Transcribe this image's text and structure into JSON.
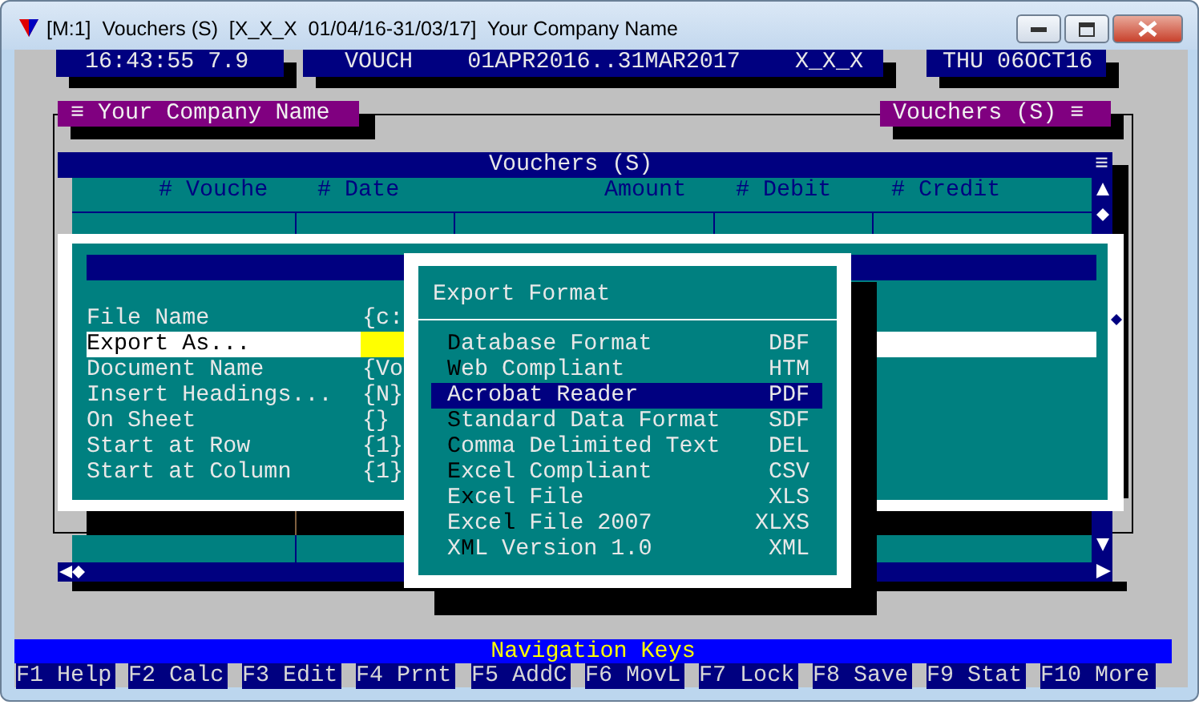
{
  "window": {
    "title": "[M:1]  Vouchers (S)  [X_X_X  01/04/16-31/03/17]  Your Company Name"
  },
  "info_boxes": [
    "16:43:55 7.9",
    "VOUCH    01APR2016..31MAR2017    X_X_X",
    "THU 06OCT16"
  ],
  "frame_labels": [
    "≡ Your Company Name",
    "Vouchers (S) ≡"
  ],
  "vouchers": {
    "title": "Vouchers (S)",
    "menu": "≡",
    "columns": [
      "# Vouche",
      "# Date",
      "Amount",
      "# Debit",
      "# Credit"
    ]
  },
  "export_dialog": {
    "fields": [
      {
        "label": "File Name",
        "value": "{c:",
        "selected": false
      },
      {
        "label": "Export As...",
        "selected": true
      },
      {
        "label": "Document Name",
        "value": "{Vo",
        "selected": false
      },
      {
        "label": "Insert Headings...",
        "value": "{N}",
        "selected": false
      },
      {
        "label": "On Sheet",
        "value": "{}",
        "selected": false
      },
      {
        "label": "Start at Row",
        "value": "{1}",
        "selected": false
      },
      {
        "label": "Start at Column",
        "value": "{1}",
        "selected": false
      }
    ]
  },
  "format_menu": {
    "title": "Export Format",
    "items": [
      {
        "parts": [
          {
            "kind": "hotkey",
            "text": "D"
          },
          {
            "kind": "plain",
            "text": "atabase Format"
          }
        ],
        "ext": "DBF",
        "selected": false
      },
      {
        "parts": [
          {
            "kind": "hotkey",
            "text": "W"
          },
          {
            "kind": "plain",
            "text": "eb Compliant"
          }
        ],
        "ext": "HTM",
        "selected": false
      },
      {
        "parts": [
          {
            "kind": "plain",
            "text": "Acrobat Reader"
          }
        ],
        "ext": "PDF",
        "selected": true
      },
      {
        "parts": [
          {
            "kind": "hotkey",
            "text": "S"
          },
          {
            "kind": "plain",
            "text": "tandard Data Format"
          }
        ],
        "ext": "SDF",
        "selected": false
      },
      {
        "parts": [
          {
            "kind": "hotkey",
            "text": "C"
          },
          {
            "kind": "plain",
            "text": "omma Delimited Text"
          }
        ],
        "ext": "DEL",
        "selected": false
      },
      {
        "parts": [
          {
            "kind": "hotkey",
            "text": "E"
          },
          {
            "kind": "plain",
            "text": "xcel Compliant"
          }
        ],
        "ext": "CSV",
        "selected": false
      },
      {
        "parts": [
          {
            "kind": "plain",
            "text": "E"
          },
          {
            "kind": "hotkey",
            "text": "x"
          },
          {
            "kind": "plain",
            "text": "cel File"
          }
        ],
        "ext": "XLS",
        "selected": false
      },
      {
        "parts": [
          {
            "kind": "plain",
            "text": "Exce"
          },
          {
            "kind": "hotkey",
            "text": "l"
          },
          {
            "kind": "plain",
            "text": " File 2007"
          }
        ],
        "ext": "XLXS",
        "selected": false
      },
      {
        "parts": [
          {
            "kind": "plain",
            "text": "X"
          },
          {
            "kind": "hotkey",
            "text": "M"
          },
          {
            "kind": "plain",
            "text": "L Version 1.0"
          }
        ],
        "ext": "XML",
        "selected": false
      }
    ]
  },
  "status_bar": {
    "title": "Navigation Keys",
    "keys": [
      "F1 Help",
      "F2 Calc",
      "F3 Edit",
      "F4 Prnt",
      "F5 AddC",
      "F6 MovL",
      "F7 Lock",
      "F8 Save",
      "F9 Stat",
      "F10 More"
    ]
  }
}
